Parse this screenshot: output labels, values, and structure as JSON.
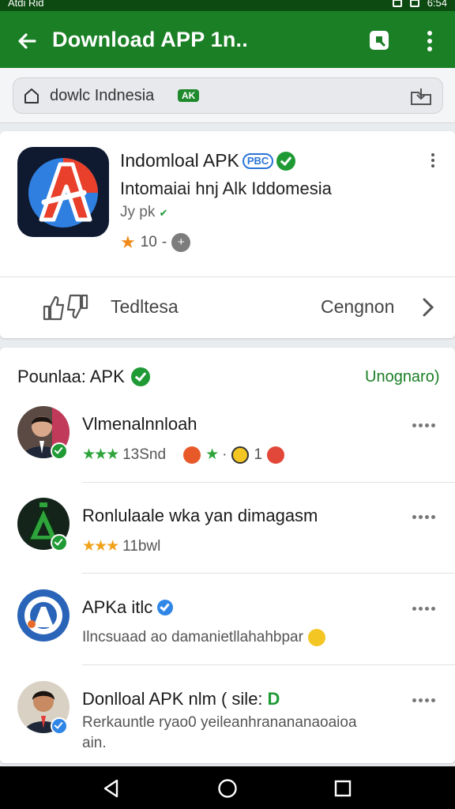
{
  "status_bar": {
    "left_text": "Atdi Rid",
    "time": "6:54"
  },
  "app_bar": {
    "title": "Download APP 1n..",
    "icons": [
      "back-arrow-icon",
      "share-icon",
      "more-vert-icon"
    ]
  },
  "search": {
    "query": "dowlc Indnesia",
    "tag": "AK"
  },
  "app": {
    "name": "Indomloal APK",
    "badge": "PBC",
    "subtitle": "Intomaiai hnj Alk Iddomesia",
    "developer": "Jy pk",
    "rating": "10",
    "rating_sep": "-",
    "rating_icon_label": "+",
    "action_left": "Tedltesa",
    "action_right": "Cengnon"
  },
  "list": {
    "heading": "Pounlaa: APK",
    "link": "Unognaro)",
    "items": [
      {
        "title": "Vlmenalnnloah",
        "stars": "★★★",
        "meta": "13Snd",
        "meta2": "·",
        "meta3": "1",
        "star2": "★"
      },
      {
        "title": "Ronlulaale wka yan dimagasm",
        "stars": "★★★",
        "meta": "11bwl"
      },
      {
        "title": "APKa itlc",
        "subtitle": "Ilncsuaad ao damanietllahahbpar"
      },
      {
        "title": "Donlloal APK nlm",
        "title_extra": "( sile:",
        "title_tag": "D",
        "subtitle": "Rerkauntle ryao0 yeileanhranananaoaioa ain."
      }
    ]
  },
  "colors": {
    "primary": "#1a7f25",
    "status": "#0d4a12",
    "verified": "#1f9a35",
    "star": "#f08a1a"
  }
}
